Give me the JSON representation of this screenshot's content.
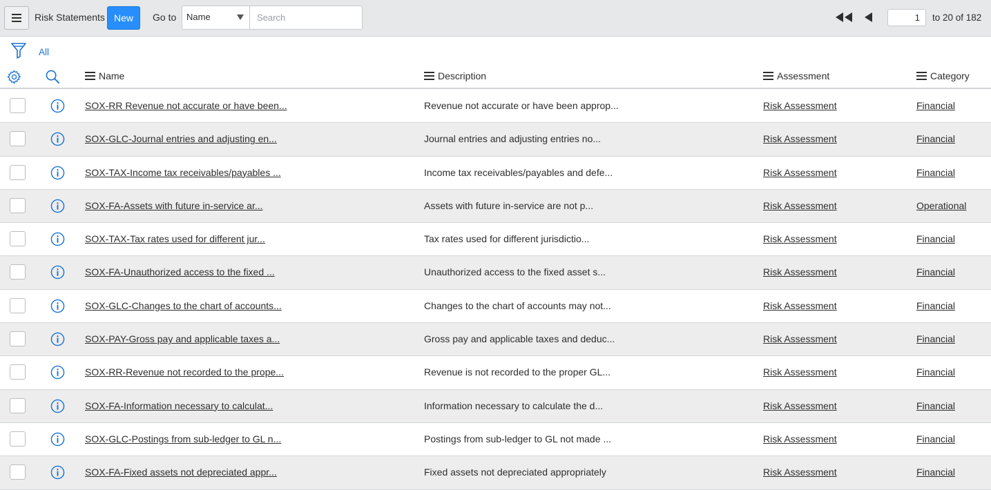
{
  "header": {
    "title": "Risk Statements",
    "new_label": "New",
    "goto_label": "Go to",
    "goto_field": "Name",
    "search_placeholder": "Search",
    "page_value": "1",
    "page_range": "to 20 of 182"
  },
  "filter": {
    "breadcrumb": "All"
  },
  "columns": {
    "name": "Name",
    "description": "Description",
    "assessment": "Assessment",
    "category": "Category"
  },
  "rows": [
    {
      "name": "SOX-RR Revenue not accurate or have been...",
      "description": "Revenue not accurate or have been approp...",
      "assessment": "Risk Assessment",
      "category": "Financial"
    },
    {
      "name": "SOX-GLC-Journal entries and adjusting en...",
      "description": "Journal entries and adjusting entries no...",
      "assessment": "Risk Assessment",
      "category": "Financial"
    },
    {
      "name": "SOX-TAX-Income tax receivables/payables ...",
      "description": "Income tax receivables/payables and defe...",
      "assessment": "Risk Assessment",
      "category": "Financial"
    },
    {
      "name": "SOX-FA-Assets with future in-service ar...",
      "description": "Assets with future in-service are not p...",
      "assessment": "Risk Assessment",
      "category": "Operational"
    },
    {
      "name": "SOX-TAX-Tax rates used for different jur...",
      "description": "Tax rates used for different jurisdictio...",
      "assessment": "Risk Assessment",
      "category": "Financial"
    },
    {
      "name": "SOX-FA-Unauthorized access to the fixed ...",
      "description": "Unauthorized access to the fixed asset s...",
      "assessment": "Risk Assessment",
      "category": "Financial"
    },
    {
      "name": "SOX-GLC-Changes to the chart of accounts...",
      "description": "Changes to the chart of accounts may not...",
      "assessment": "Risk Assessment",
      "category": "Financial"
    },
    {
      "name": "SOX-PAY-Gross pay and applicable taxes a...",
      "description": "Gross pay and applicable taxes and deduc...",
      "assessment": "Risk Assessment",
      "category": "Financial"
    },
    {
      "name": "SOX-RR-Revenue not recorded to the prope...",
      "description": "Revenue is not recorded to the proper GL...",
      "assessment": "Risk Assessment",
      "category": "Financial"
    },
    {
      "name": "SOX-FA-Information necessary to calculat...",
      "description": "Information necessary to calculate the d...",
      "assessment": "Risk Assessment",
      "category": "Financial"
    },
    {
      "name": "SOX-GLC-Postings from sub-ledger to GL n...",
      "description": "Postings from sub-ledger to GL not made ...",
      "assessment": "Risk Assessment",
      "category": "Financial"
    },
    {
      "name": "SOX-FA-Fixed assets not depreciated appr...",
      "description": "Fixed assets not depreciated appropriately",
      "assessment": "Risk Assessment",
      "category": "Financial"
    }
  ],
  "colors": {
    "accent": "#278efc",
    "link_blue": "#1a73d0",
    "header_bg": "#e6e8ea",
    "row_alt_bg": "#ededed"
  },
  "icons": {
    "menu": "hamburger-menu-icon",
    "filter": "funnel-filter-icon",
    "settings": "gear-icon",
    "search": "magnifier-icon",
    "info": "info-circle-icon",
    "first_page": "double-left-arrow-icon",
    "prev_page": "left-arrow-icon"
  }
}
